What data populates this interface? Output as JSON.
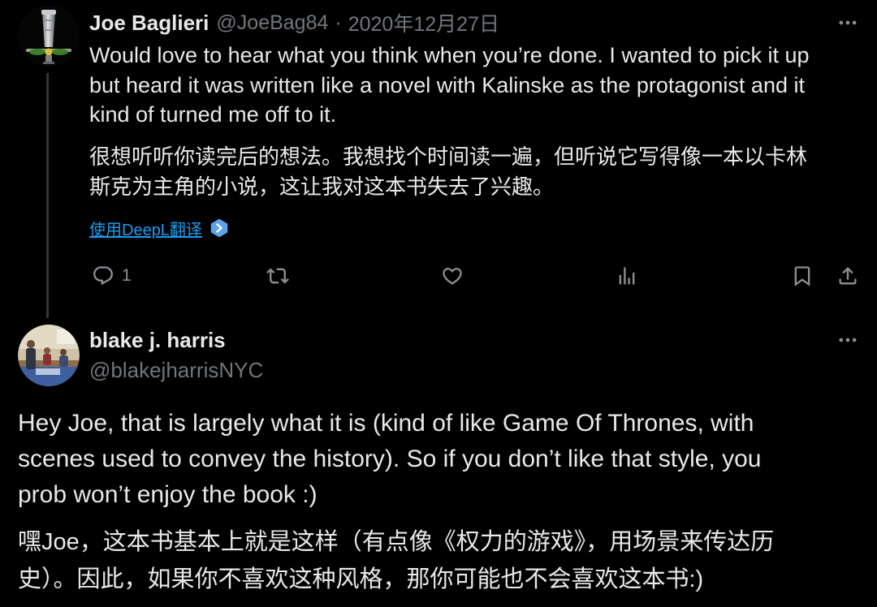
{
  "app": "X",
  "colors": {
    "background": "#000000",
    "text": "#e7e9ea",
    "muted": "#71767b",
    "icon": "#8b9095",
    "link": "#1d9bf0",
    "thread": "#333639",
    "deepl": "#5ba4e5"
  },
  "tweets": [
    {
      "author": {
        "name": "Joe Baglieri",
        "handle": "@JoeBag84",
        "separator": "·",
        "date": "2020年12月27日",
        "avatar": "trophy-avatar"
      },
      "more_icon": "more-icon",
      "text_lines": [
        "Would love to hear what you think when you’re done. I wanted to pick it up",
        "but heard it was written like a novel with Kalinske as the protagonist and it",
        "kind of turned me off to it."
      ],
      "translation_lines": [
        "很想听听你读完后的想法。我想找个时间读一遍，但听说它写得像一本以卡林",
        "斯克为主角的小说，这让我对这本书失去了兴趣。"
      ],
      "translate": {
        "label": "使用DeepL翻译",
        "icon": "deepl-icon"
      },
      "actions": {
        "reply": {
          "icon": "reply-icon",
          "count": "1"
        },
        "retweet": {
          "icon": "retweet-icon"
        },
        "like": {
          "icon": "heart-icon"
        },
        "views": {
          "icon": "views-icon"
        },
        "bookmark": {
          "icon": "bookmark-icon"
        },
        "share": {
          "icon": "share-icon"
        }
      }
    },
    {
      "author": {
        "name": "blake j. harris",
        "handle": "@blakejharrisNYC",
        "avatar": "photo-avatar"
      },
      "more_icon": "more-icon",
      "text_lines": [
        "Hey Joe, that is largely what it is (kind of like Game Of Thrones, with",
        "scenes used to convey the history). So if you don’t like that style, you",
        "prob won’t enjoy the book :)"
      ],
      "translation_lines": [
        "嘿Joe，这本书基本上就是这样（有点像《权力的游戏》，用场景来传达历",
        "史）。因此，如果你不喜欢这种风格，那你可能也不会喜欢这本书:)"
      ]
    }
  ]
}
